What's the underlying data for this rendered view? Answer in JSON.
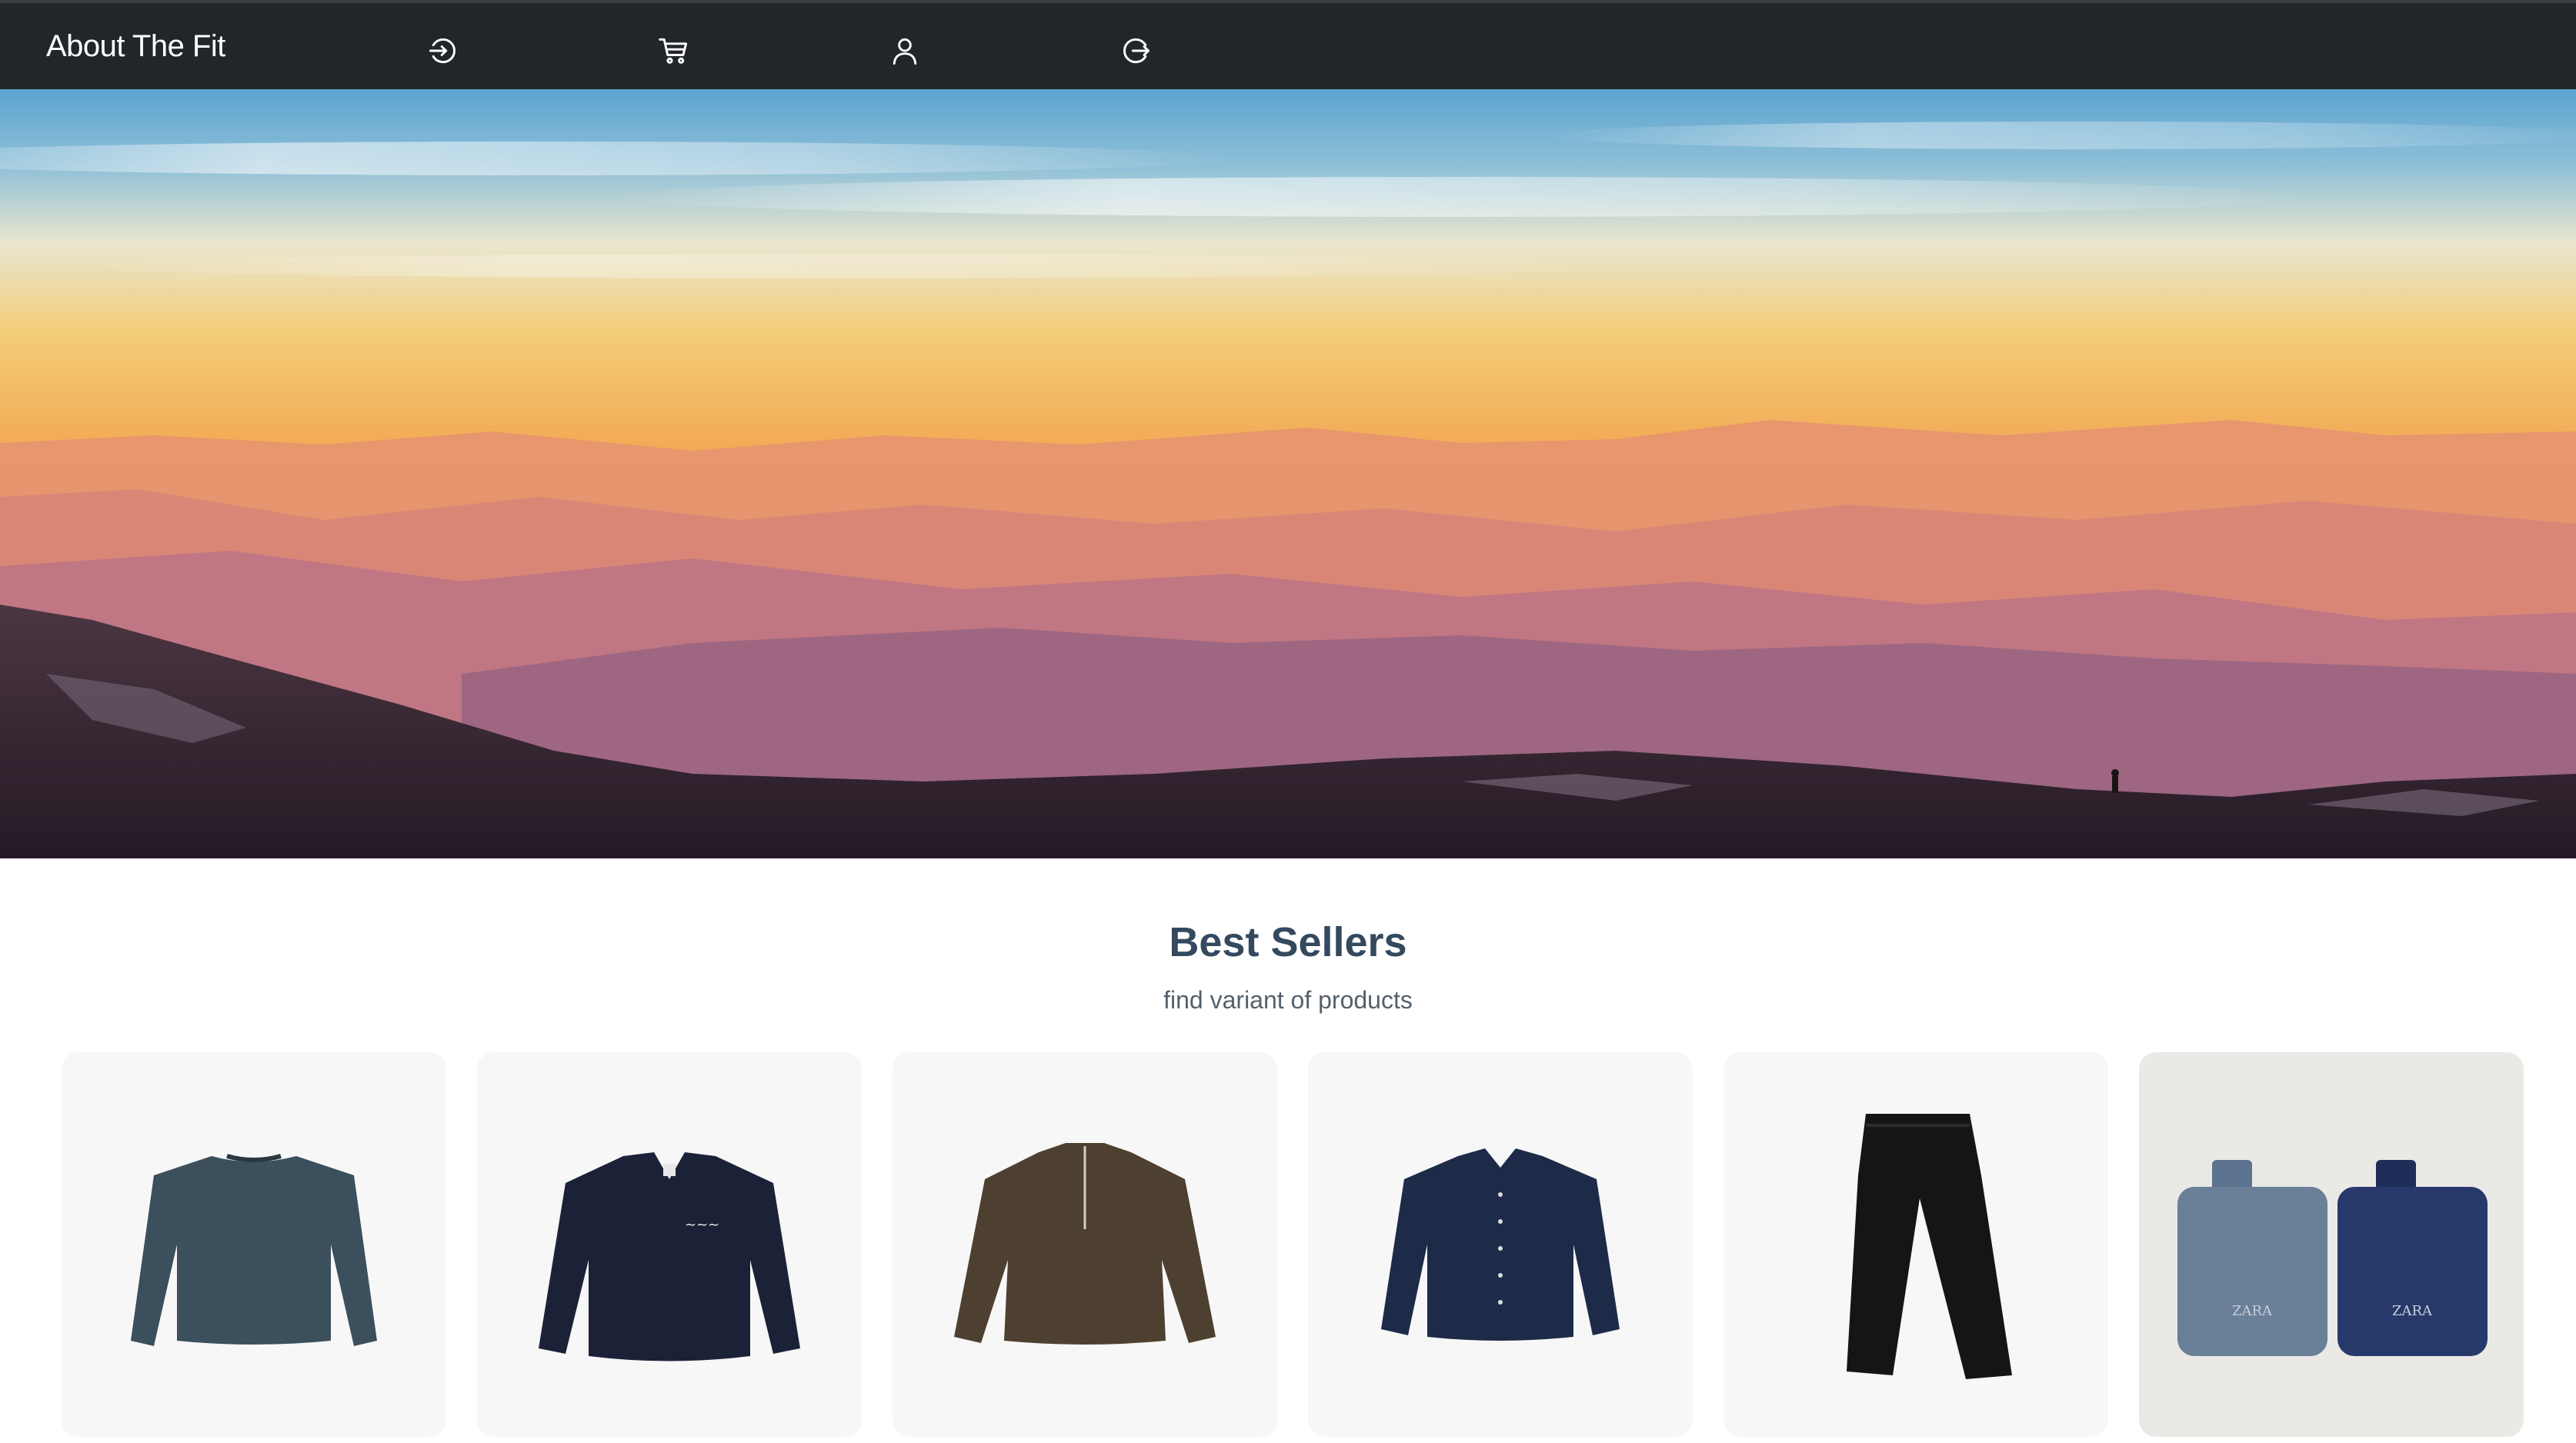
{
  "navbar": {
    "brand": "About The Fit",
    "icons": [
      "login-icon",
      "cart-icon",
      "user-icon",
      "logout-icon"
    ]
  },
  "hero": {
    "image": "mountain-sunset-landscape"
  },
  "best_sellers": {
    "title": "Best Sellers",
    "subtitle": "find variant of products"
  },
  "products": [
    {
      "name": "teal-long-sleeve-tee",
      "color": "#3b4f5c"
    },
    {
      "name": "navy-polo-sweatshirt",
      "color": "#1b2238"
    },
    {
      "name": "brown-half-zip-sweater",
      "color": "#4e4030"
    },
    {
      "name": "navy-button-shirt",
      "color": "#1d2b48"
    },
    {
      "name": "black-jeans",
      "color": "#151515"
    },
    {
      "name": "zara-fragrance-pair",
      "color": "#6a7f98",
      "labels": [
        "ZARA",
        "ZARA"
      ]
    }
  ],
  "colors": {
    "navbar_bg": "#22262a",
    "title": "#34495e",
    "subtitle": "#55606c",
    "card_bg": "#f7f7f7"
  }
}
